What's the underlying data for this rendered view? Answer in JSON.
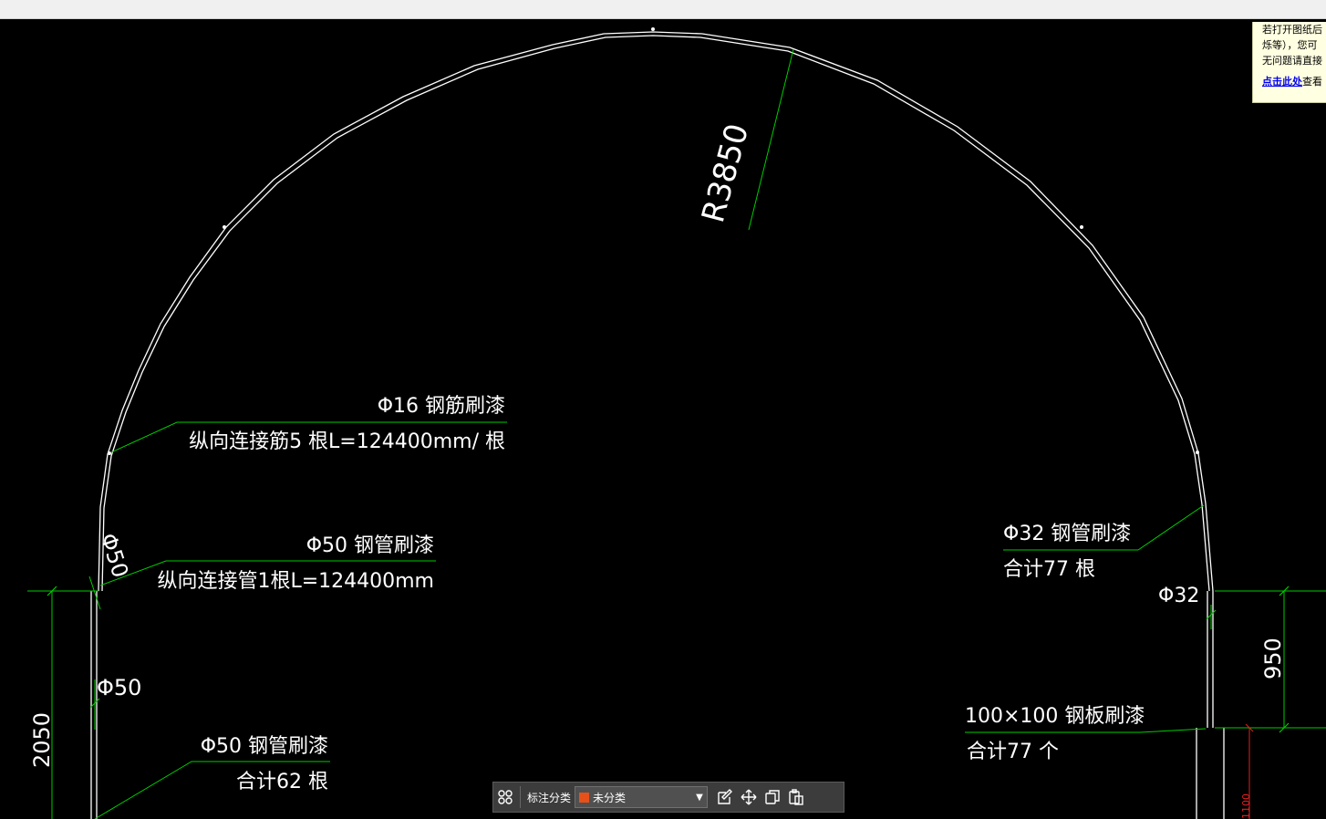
{
  "notice": {
    "lines": [
      "若打开图纸后",
      "烁等），您可",
      "无问题请直接"
    ],
    "link_text": "点击此处",
    "link_suffix": "查看"
  },
  "drawing": {
    "labels": {
      "radius": "R3850",
      "bar16_title": "Φ16 钢筋刷漆",
      "bar16_detail": "纵向连接筋5 根L=124400mm/ 根",
      "pipe50_title": "Φ50 钢管刷漆",
      "pipe50_detail": "纵向连接管1根L=124400mm",
      "pipe50_dim": "Φ50",
      "pipe50_small": "Φ50",
      "pipe50b_title": "Φ50 钢管刷漆",
      "pipe50b_total": "合计62 根",
      "pipe32_title": "Φ32 钢管刷漆",
      "pipe32_total": "合计77 根",
      "pipe32_dim": "Φ32",
      "dim_950": "950",
      "dim_2050": "2050",
      "dim_1100": "1100",
      "plate_title": "100×100 钢板刷漆",
      "plate_total": "合计77 个"
    }
  },
  "toolbar": {
    "category_label": "标注分类",
    "category_value": "未分类",
    "category_color": "#e8501a"
  },
  "colors": {
    "drawing_line": "#ffffff",
    "dimension_line": "#00cc00",
    "accent_red": "#e02020",
    "background": "#000000"
  }
}
